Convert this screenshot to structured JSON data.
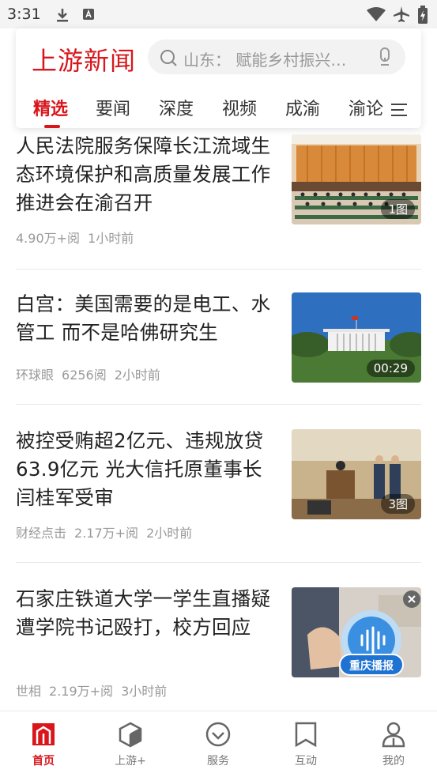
{
  "status_bar": {
    "time": "3:31"
  },
  "header": {
    "logo": "上游新闻",
    "search_placeholder": "山东：  赋能乡村振兴…",
    "tabs": [
      {
        "label": "精选",
        "active": true
      },
      {
        "label": "要闻"
      },
      {
        "label": "深度"
      },
      {
        "label": "视频"
      },
      {
        "label": "成渝"
      },
      {
        "label": "渝论"
      }
    ]
  },
  "feed": [
    {
      "title": "人民法院服务保障长江流域生态环境保护和高质量发展工作推进会在渝召开",
      "source": "",
      "reads": "4.90万+阅",
      "time": "1小时前",
      "badge": "1图"
    },
    {
      "title": "白宫：美国需要的是电工、水管工 而不是哈佛研究生",
      "source": "环球眼",
      "reads": "6256阅",
      "time": "2小时前",
      "badge": "00:29"
    },
    {
      "title": "被控受贿超2亿元、违规放贷63.9亿元 光大信托原董事长闫桂军受审",
      "source": "财经点击",
      "reads": "2.17万+阅",
      "time": "2小时前",
      "badge": "3图"
    },
    {
      "title": "石家庄铁道大学一学生直播疑遭学院书记殴打，校方回应",
      "source": "世相",
      "reads": "2.19万+阅",
      "time": "3小时前",
      "badge": ""
    }
  ],
  "float_widget": {
    "label": "重庆播报"
  },
  "bottom_nav": [
    {
      "label": "首页",
      "icon": "home-icon",
      "active": true
    },
    {
      "label": "上游+",
      "icon": "cube-icon"
    },
    {
      "label": "服务",
      "icon": "service-icon"
    },
    {
      "label": "互动",
      "icon": "bookmark-icon"
    },
    {
      "label": "我的",
      "icon": "profile-icon"
    }
  ],
  "colors": {
    "brand": "#d8161c",
    "meta": "#999999"
  }
}
